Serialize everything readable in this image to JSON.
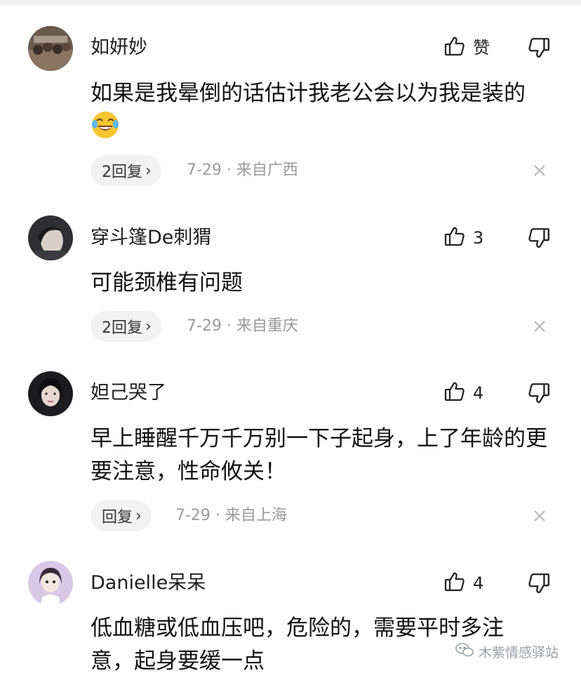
{
  "comments": [
    {
      "username": "如妍妙",
      "like_label": "赞",
      "text": "如果是我晕倒的话估计我老公会以为我是装的",
      "emoji": "crying-laughing-emoji",
      "reply_label": "2回复",
      "meta": "7-29 · 来自广西"
    },
    {
      "username": "穿斗篷De刺猬",
      "like_label": "3",
      "text": "可能颈椎有问题",
      "reply_label": "2回复",
      "meta": "7-29 · 来自重庆"
    },
    {
      "username": "妲己哭了",
      "like_label": "4",
      "text": "早上睡醒千万千万别一下子起身，上了年龄的更要注意，性命攸关！",
      "reply_label": "回复",
      "meta": "7-29 · 来自上海"
    },
    {
      "username": "Danielle呆呆",
      "like_label": "4",
      "text": "低血糖或低血压吧，危险的，需要平时多注意，起身要缓一点"
    }
  ],
  "watermark": {
    "text": "木紫情感驿站",
    "icon": "wechat-icon"
  },
  "colors": {
    "meta": "#9a9a9a",
    "pill_bg": "#f2f2f2",
    "divider": "#f1f1f1"
  }
}
